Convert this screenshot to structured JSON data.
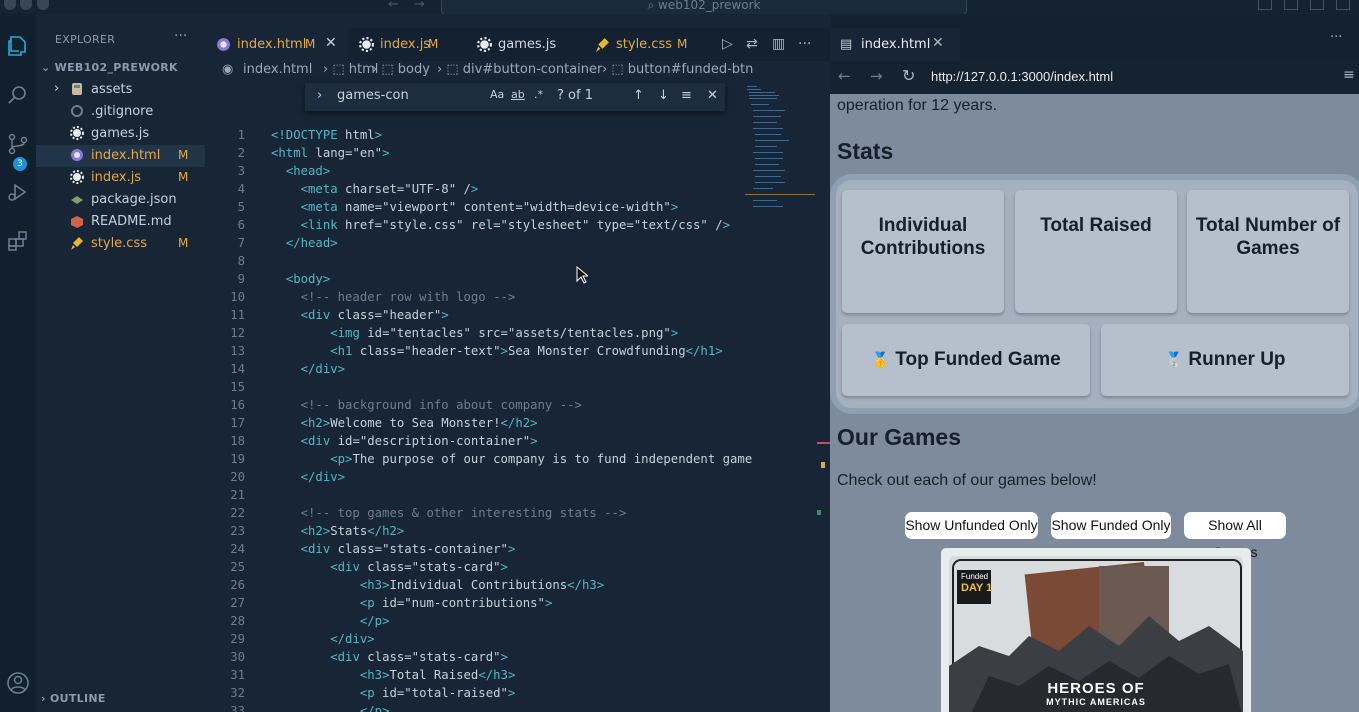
{
  "window": {
    "search": "web102_prework"
  },
  "activity_bar": {
    "scm_badge": "3"
  },
  "explorer": {
    "title": "EXPLORER",
    "project": "WEB102_PREWORK",
    "items": [
      {
        "label": "assets",
        "mark": ""
      },
      {
        "label": ".gitignore",
        "mark": ""
      },
      {
        "label": "games.js",
        "mark": ""
      },
      {
        "label": "index.html",
        "mark": "M"
      },
      {
        "label": "index.js",
        "mark": "M"
      },
      {
        "label": "package.json",
        "mark": ""
      },
      {
        "label": "README.md",
        "mark": ""
      },
      {
        "label": "style.css",
        "mark": "M"
      }
    ],
    "outline": "OUTLINE"
  },
  "editor": {
    "tabs": [
      {
        "label": "index.html",
        "mark": "M"
      },
      {
        "label": "index.js",
        "mark": "M"
      },
      {
        "label": "games.js",
        "mark": ""
      },
      {
        "label": "style.css",
        "mark": "M"
      }
    ],
    "breadcrumb": [
      "index.html",
      "html",
      "body",
      "div#button-container",
      "button#funded-btn"
    ],
    "find": {
      "value": "games-con",
      "result": "? of 1",
      "aa": "Aa",
      "word": "ab",
      "regex": ".*"
    },
    "lines": [
      {
        "n": "1",
        "t": "<!DOCTYPE html>"
      },
      {
        "n": "2",
        "t": "<html lang=\"en\">"
      },
      {
        "n": "3",
        "t": "  <head>"
      },
      {
        "n": "4",
        "t": "    <meta charset=\"UTF-8\" />"
      },
      {
        "n": "5",
        "t": "    <meta name=\"viewport\" content=\"width=device-width\">"
      },
      {
        "n": "6",
        "t": "    <link href=\"style.css\" rel=\"stylesheet\" type=\"text/css\" />"
      },
      {
        "n": "7",
        "t": "  </head>"
      },
      {
        "n": "8",
        "t": ""
      },
      {
        "n": "9",
        "t": "  <body>"
      },
      {
        "n": "10",
        "t": "    <!-- header row with logo -->"
      },
      {
        "n": "11",
        "t": "    <div class=\"header\">"
      },
      {
        "n": "12",
        "t": "        <img id=\"tentacles\" src=\"assets/tentacles.png\">"
      },
      {
        "n": "13",
        "t": "        <h1 class=\"header-text\">Sea Monster Crowdfunding</h1>"
      },
      {
        "n": "14",
        "t": "    </div>"
      },
      {
        "n": "15",
        "t": ""
      },
      {
        "n": "16",
        "t": "    <!-- background info about company -->"
      },
      {
        "n": "17",
        "t": "    <h2>Welcome to Sea Monster!</h2>"
      },
      {
        "n": "18",
        "t": "    <div id=\"description-container\">"
      },
      {
        "n": "19",
        "t": "        <p>The purpose of our company is to fund independent game"
      },
      {
        "n": "20",
        "t": "    </div>"
      },
      {
        "n": "21",
        "t": ""
      },
      {
        "n": "22",
        "t": "    <!-- top games & other interesting stats -->"
      },
      {
        "n": "23",
        "t": "    <h2>Stats</h2>"
      },
      {
        "n": "24",
        "t": "    <div class=\"stats-container\">"
      },
      {
        "n": "25",
        "t": "        <div class=\"stats-card\">"
      },
      {
        "n": "26",
        "t": "            <h3>Individual Contributions</h3>"
      },
      {
        "n": "27",
        "t": "            <p id=\"num-contributions\">"
      },
      {
        "n": "28",
        "t": "            </p>"
      },
      {
        "n": "29",
        "t": "        </div>"
      },
      {
        "n": "30",
        "t": "        <div class=\"stats-card\">"
      },
      {
        "n": "31",
        "t": "            <h3>Total Raised</h3>"
      },
      {
        "n": "32",
        "t": "            <p id=\"total-raised\">"
      },
      {
        "n": "33",
        "t": "            </p>"
      }
    ]
  },
  "browser": {
    "tab": "index.html",
    "url": "http://127.0.0.1:3000/index.html",
    "page": {
      "intro_tail": "operation for 12 years.",
      "stats_heading": "Stats",
      "cards": [
        "Individual Contributions",
        "Total Raised",
        "Total Number of Games"
      ],
      "top_funded": "Top Funded Game",
      "runner_up": "Runner Up",
      "medal_gold": "🥇",
      "medal_silver": "🥈",
      "games_heading": "Our Games",
      "games_sub": "Check out each of our games below!",
      "buttons": [
        "Show Unfunded Only",
        "Show Funded Only",
        "Show All Games"
      ],
      "game_title_1": "HEROES OF",
      "game_title_2": "MYTHIC AMERICAS",
      "game_badge_1": "Funded",
      "game_badge_2": "DAY 1"
    }
  },
  "colors": {
    "modified": "#e2a94a",
    "accent": "#1e8fd8",
    "tag": "#56b6c2",
    "attr": "#dcc86e",
    "string": "#9ece6a",
    "comment": "#6d7d8f"
  }
}
